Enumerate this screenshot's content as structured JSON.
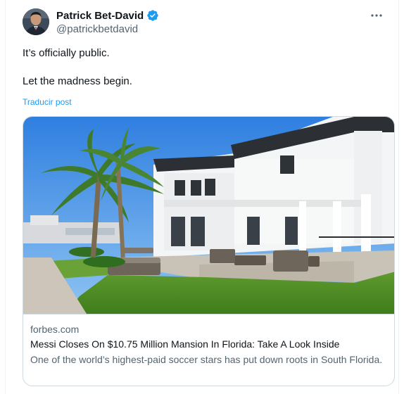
{
  "author": {
    "display_name": "Patrick Bet-David",
    "handle": "@patrickbetdavid",
    "verified": true,
    "avatar_icon": "person-portrait"
  },
  "post": {
    "lines": [
      "It’s officially public.",
      "Let the madness begin."
    ],
    "translate_label": "Traducir post"
  },
  "menu": {
    "icon": "more-horizontal-icon"
  },
  "link_card": {
    "domain": "forbes.com",
    "title": "Messi Closes On $10.75 Million Mansion In Florida: Take A Look Inside",
    "description": "One of the world’s highest-paid soccer stars has put down roots in South Florida."
  },
  "colors": {
    "link_blue": "#1d9bf0",
    "secondary_text": "#536471",
    "primary_text": "#0f1419",
    "border": "#cfd9de",
    "verified_badge": "#1d9bf0"
  }
}
